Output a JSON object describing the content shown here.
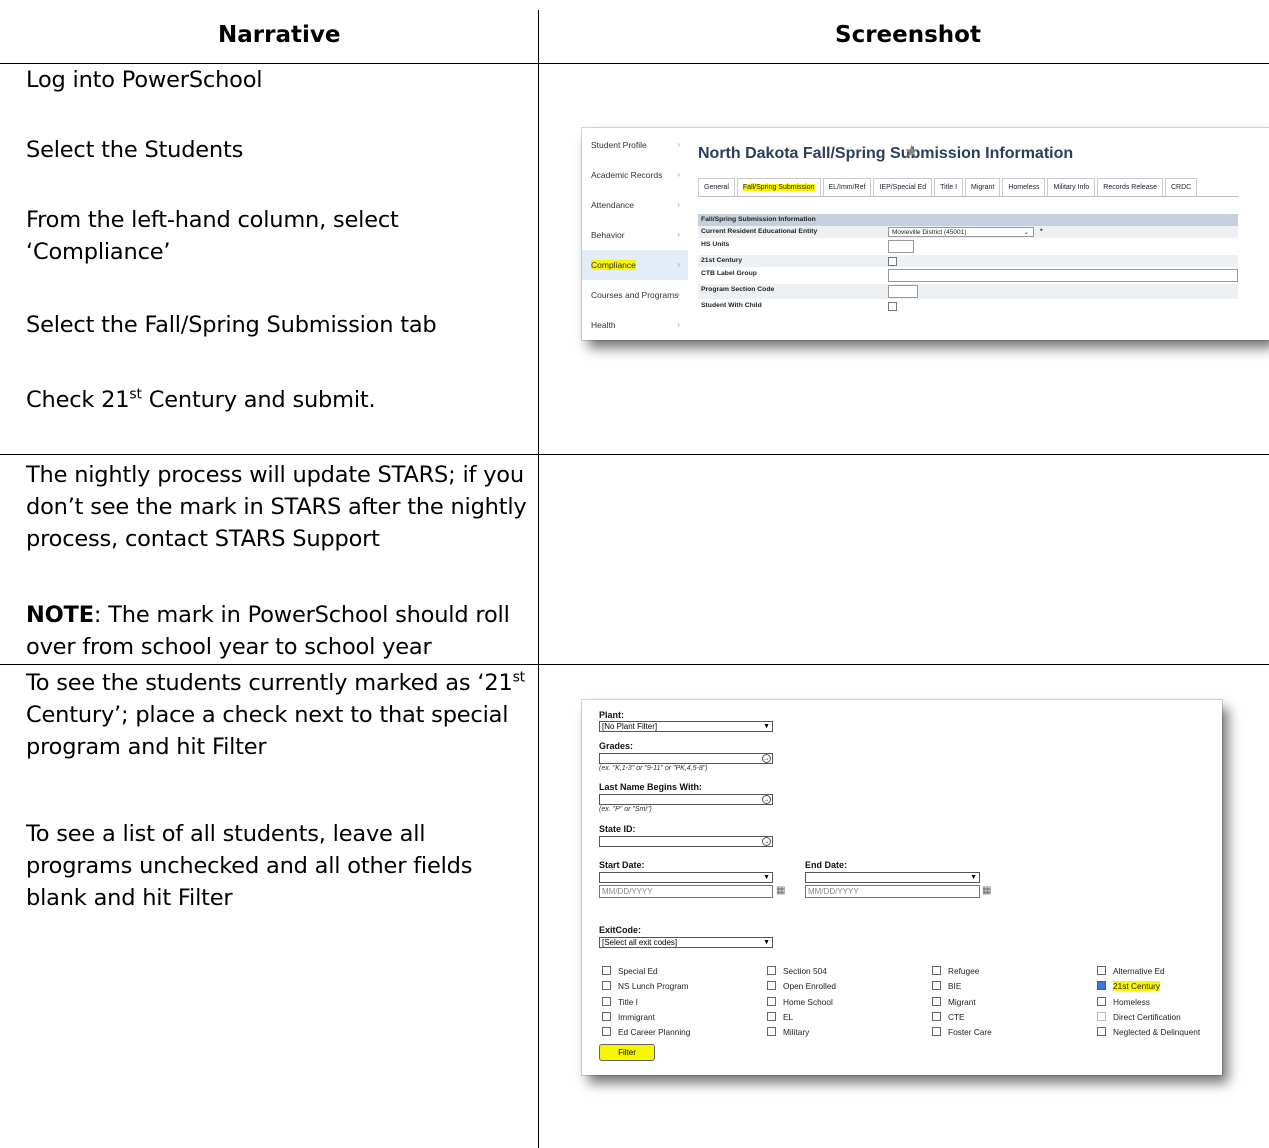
{
  "headers": {
    "narrative": "Narrative",
    "screenshot": "Screenshot"
  },
  "row1": {
    "steps": [
      "Log into PowerSchool",
      "Select the Students",
      "From the left-hand column, select ‘Compliance’",
      "Select the Fall/Spring Submission tab"
    ],
    "check_pre": "Check 21",
    "check_sup": "st",
    "check_post": " Century and submit."
  },
  "row2": {
    "line1": "The nightly process will update STARS; if you don’t see the mark in STARS after the nightly process, contact STARS Support",
    "note_label": "NOTE",
    "note_text": ":  The mark in PowerSchool should roll over from school year to school year"
  },
  "row3": {
    "p1_pre": "To see the students currently marked as ‘21",
    "p1_sup": "st",
    "p1_post": " Century’; place a check next to that special program and hit Filter",
    "p2": "To see a list of all students, leave all programs unchecked and all other fields blank and hit Filter"
  },
  "shot1": {
    "sidebar": [
      "Student Profile",
      "Academic Records",
      "Attendance",
      "Behavior",
      "Compliance",
      "Courses and Programs",
      "Health"
    ],
    "title": "North Dakota Fall/Spring Submission Information",
    "tabs": [
      "General",
      "Fall/Spring Submission",
      "EL/Imm/Ref",
      "IEP/Special Ed",
      "Title I",
      "Migrant",
      "Homeless",
      "Military Info",
      "Records Release",
      "CRDC"
    ],
    "section": "Fall/Spring Submission Information",
    "fields": [
      "Current Resident Educational Entity",
      "HS Units",
      "21st Century",
      "CTB Label Group",
      "Program Section Code",
      "Student With Child"
    ],
    "entity_value": "Movieville District (45001)",
    "required_mark": "*"
  },
  "shot2": {
    "plant_label": "Plant:",
    "plant_value": "[No Plant Filter]",
    "grades_label": "Grades:",
    "grades_hint": "(ex. \"K,1-3\" or \"9-11\" or \"PK,4,5-8\")",
    "lastname_label": "Last Name Begins With:",
    "lastname_hint": "(ex. \"P\" or \"Smi\")",
    "stateid_label": "State ID:",
    "start_label": "Start Date:",
    "end_label": "End Date:",
    "date_placeholder": "MM/DD/YYYY",
    "exit_label": "ExitCode:",
    "exit_value": "[Select all exit codes]",
    "programs": [
      [
        "Special Ed",
        "NS Lunch Program",
        "Title I",
        "Immigrant",
        "Ed Career Planning"
      ],
      [
        "Section 504",
        "Open Enrolled",
        "Home School",
        "EL",
        "Military"
      ],
      [
        "Refugee",
        "BIE",
        "Migrant",
        "CTE",
        "Foster Care"
      ],
      [
        "Alternative Ed",
        "21st Century",
        "Homeless",
        "Direct Certification",
        "Neglected & Delinquent"
      ]
    ],
    "filter_label": "Filter"
  }
}
